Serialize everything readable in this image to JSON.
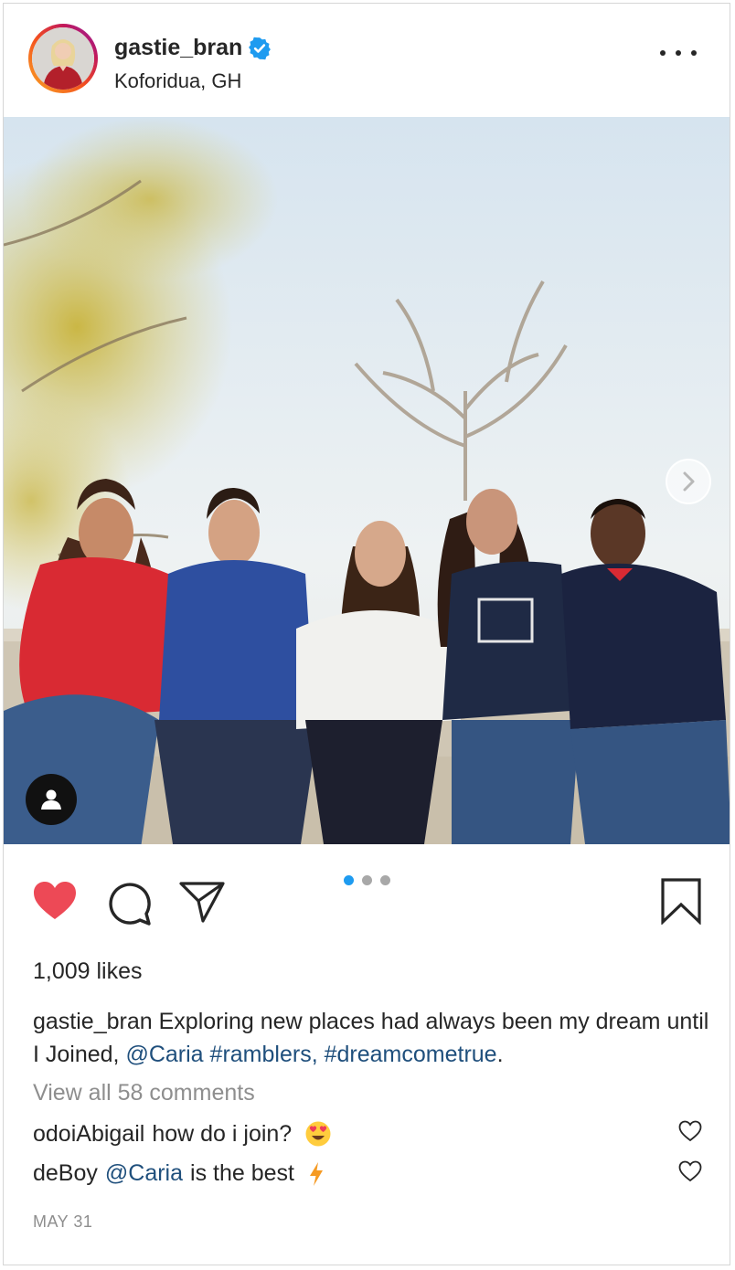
{
  "post": {
    "header": {
      "username": "gastie_bran",
      "location": "Koforidua, GH",
      "verified": true,
      "verified_color": "#1e9bf0",
      "more_icon": "more-horizontal-icon"
    },
    "photo": {
      "carousel_total": 3,
      "carousel_active": 1,
      "next_icon": "chevron-right-icon",
      "tag_icon": "user-tag-icon"
    },
    "actions": {
      "like_icon": "heart-filled-icon",
      "like_color": "#ed4956",
      "comment_icon": "comment-icon",
      "share_icon": "paper-plane-icon",
      "save_icon": "bookmark-icon"
    },
    "likes_text": "1,009 likes",
    "caption": {
      "username": "gastie_bran",
      "text": "Exploring new places had always been my dream until I Joined,",
      "mention": "@Caria",
      "hashtag1": "#ramblers",
      "separator": ",",
      "hashtag2": "#dreamcometrue",
      "end": "."
    },
    "view_comments": "View all 58 comments",
    "comments": [
      {
        "username": "odoiAbigail",
        "text": "how do i join?",
        "emoji": "😍"
      },
      {
        "username": "deBoy",
        "mention": "@Caria",
        "text": "is the best",
        "emoji": "⚡"
      }
    ],
    "date": "MAY 31",
    "link_color": "#1f4f7c"
  }
}
